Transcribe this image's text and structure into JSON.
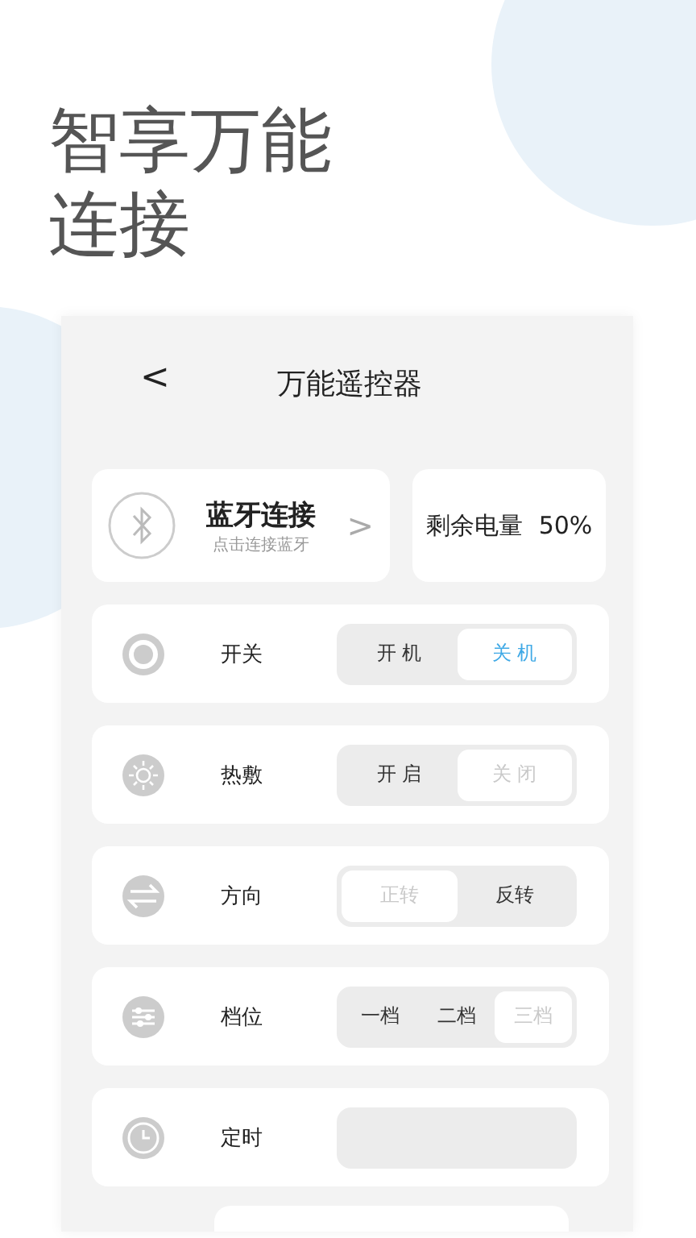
{
  "headline": [
    "智享万能",
    "连接"
  ],
  "header": {
    "back": "<",
    "title": "万能遥控器"
  },
  "bluetooth": {
    "title": "蓝牙连接",
    "subtitle": "点击连接蓝牙",
    "arrow": ">"
  },
  "battery": {
    "label": "剩余电量",
    "value": "50%"
  },
  "controls": [
    {
      "kind": "power",
      "label": "开关",
      "options": [
        {
          "label": "开 机",
          "selected": false,
          "color": "#333333"
        },
        {
          "label": "关 机",
          "selected": true,
          "color": "#3fa9e6"
        }
      ]
    },
    {
      "kind": "heat",
      "label": "热敷",
      "options": [
        {
          "label": "开 启",
          "selected": false,
          "color": "#333333"
        },
        {
          "label": "关 闭",
          "selected": true,
          "color": "#c9c9c9"
        }
      ]
    },
    {
      "kind": "direction",
      "label": "方向",
      "options": [
        {
          "label": "正转",
          "selected": true,
          "color": "#c9c9c9"
        },
        {
          "label": "反转",
          "selected": false,
          "color": "#333333"
        }
      ]
    },
    {
      "kind": "level",
      "label": "档位",
      "options": [
        {
          "label": "一档",
          "selected": false,
          "color": "#333333"
        },
        {
          "label": "二档",
          "selected": false,
          "color": "#333333"
        },
        {
          "label": "三档",
          "selected": true,
          "color": "#c9c9c9"
        }
      ]
    },
    {
      "kind": "timer",
      "label": "定时"
    }
  ]
}
